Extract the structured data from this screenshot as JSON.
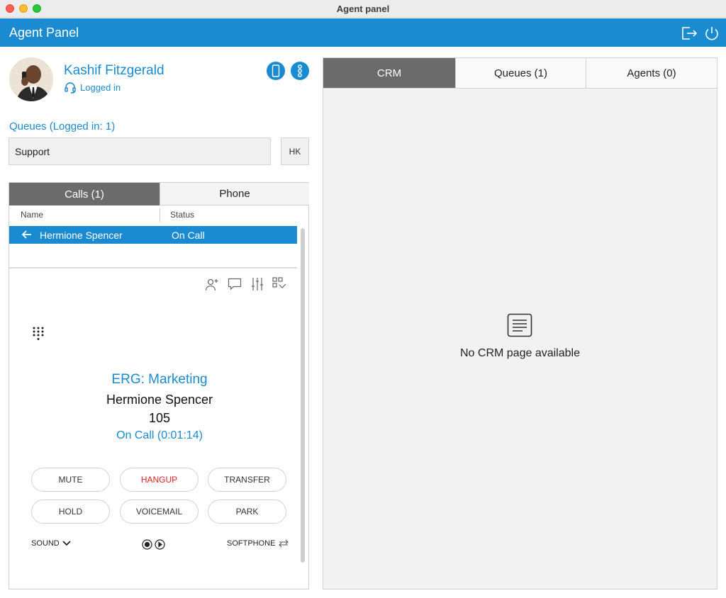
{
  "window": {
    "title": "Agent panel"
  },
  "header": {
    "title": "Agent Panel",
    "logout_icon": "logout-icon",
    "power_icon": "power-icon",
    "color": "#1a8bd0"
  },
  "agent": {
    "name": "Kashif Fitzgerald",
    "status": "Logged in",
    "status_icon": "headset-icon"
  },
  "queues": {
    "label": "Queues (Logged in: 1)",
    "selected": "Support",
    "hk_label": "HK"
  },
  "calls_panel": {
    "tabs": [
      {
        "label": "Calls (1)",
        "active": true
      },
      {
        "label": "Phone",
        "active": false
      }
    ],
    "columns": [
      "Name",
      "Status"
    ],
    "rows": [
      {
        "direction_icon": "arrow-left-icon",
        "name": "Hermione Spencer",
        "status": "On Call"
      }
    ],
    "tools": [
      "add-contact-icon",
      "chat-icon",
      "settings-sliders-icon",
      "qr-code-icon"
    ]
  },
  "active_call": {
    "queue": "ERG: Marketing",
    "caller": "Hermione Spencer",
    "extension": "105",
    "status": "On Call (0:01:14)"
  },
  "call_buttons": [
    {
      "label": "MUTE"
    },
    {
      "label": "HANGUP",
      "color": "#e02020"
    },
    {
      "label": "TRANSFER"
    },
    {
      "label": "HOLD"
    },
    {
      "label": "VOICEMAIL"
    },
    {
      "label": "PARK"
    }
  ],
  "footer": {
    "sound": "SOUND",
    "softphone": "SOFTPHONE"
  },
  "right_panel": {
    "tabs": [
      {
        "label": "CRM",
        "active": true
      },
      {
        "label": "Queues (1)",
        "active": false
      },
      {
        "label": "Agents (0)",
        "active": false
      }
    ],
    "empty_message": "No CRM page available"
  }
}
